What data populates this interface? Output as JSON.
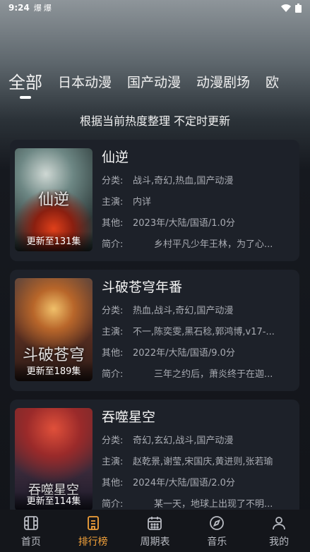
{
  "status": {
    "time": "9:24",
    "notif1": "爆",
    "notif2": "爆"
  },
  "tabs": [
    "全部",
    "日本动漫",
    "国产动漫",
    "动漫剧场",
    "欧"
  ],
  "subtitle": "根据当前热度整理 不定时更新",
  "labels": {
    "category": "分类:",
    "cast": "主演:",
    "other": "其他:",
    "intro": "简介:"
  },
  "cards": [
    {
      "title": "仙逆",
      "poster_text": "仙逆",
      "episode": "更新至131集",
      "category": "战斗,奇幻,热血,国产动漫",
      "cast": "内详",
      "other": "2023年/大陆/国语/1.0分",
      "intro": "乡村平凡少年王林，为了心..."
    },
    {
      "title": "斗破苍穹年番",
      "poster_text": "斗破苍穹",
      "episode": "更新至189集",
      "category": "热血,战斗,奇幻,国产动漫",
      "cast": "不一,陈奕雯,黑石稔,郭鸿博,v17-...",
      "other": "2022年/大陆/国语/9.0分",
      "intro": "三年之约后，萧炎终于在迦..."
    },
    {
      "title": "吞噬星空",
      "poster_text": "吞噬星空",
      "episode": "更新至114集",
      "category": "奇幻,玄幻,战斗,国产动漫",
      "cast": "赵乾景,谢莹,宋国庆,黄进则,张若瑜",
      "other": "2024年/大陆/国语/2.0分",
      "intro": "某一天，地球上出现了不明..."
    }
  ],
  "nav": [
    {
      "label": "首页",
      "icon": "film-icon"
    },
    {
      "label": "排行榜",
      "icon": "ranking-icon"
    },
    {
      "label": "周期表",
      "icon": "calendar-icon"
    },
    {
      "label": "音乐",
      "icon": "compass-icon"
    },
    {
      "label": "我的",
      "icon": "user-icon"
    }
  ],
  "colors": {
    "accent": "#f2a13a",
    "card_bg": "#1d2129"
  }
}
